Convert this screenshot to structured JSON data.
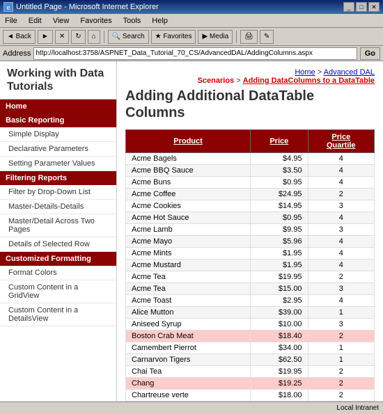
{
  "window": {
    "title": "Untitled Page - Microsoft Internet Explorer",
    "icon": "🌐"
  },
  "menu": {
    "items": [
      "File",
      "Edit",
      "View",
      "Favorites",
      "Tools",
      "Help"
    ]
  },
  "toolbar": {
    "back_label": "◄ Back",
    "search_label": "Search",
    "favorites_label": "★ Favorites",
    "media_label": "Media"
  },
  "address": {
    "label": "Address",
    "url": "http://localhost:3758/ASPNET_Data_Tutorial_70_CS/AdvancedDAL/AddingColumns.aspx",
    "go_label": "Go"
  },
  "page": {
    "title": "Working with Data Tutorials",
    "heading": "Adding Additional DataTable Columns"
  },
  "breadcrumb": {
    "home": "Home",
    "advanced_dal": "Advanced DAL",
    "scenarios": "Scenarios",
    "current": "Adding DataColumns to a DataTable"
  },
  "sidebar": {
    "home_label": "Home",
    "sections": [
      {
        "header": "Basic Reporting",
        "items": [
          "Simple Display",
          "Declarative Parameters",
          "Setting Parameter Values"
        ]
      },
      {
        "header": "Filtering Reports",
        "items": [
          "Filter by Drop-Down List",
          "Master-Details-Details",
          "Master/Detail Across Two Pages",
          "Details of Selected Row"
        ]
      },
      {
        "header": "Customized Formatting",
        "items": [
          "Format Colors",
          "Custom Content in a GridView",
          "Custom Content in a DetailsView"
        ]
      }
    ]
  },
  "table": {
    "headers": [
      "Product",
      "Price",
      "Price Quartile"
    ],
    "rows": [
      {
        "product": "Acme Bagels",
        "price": "$4.95",
        "quartile": "4"
      },
      {
        "product": "Acme BBQ Sauce",
        "price": "$3.50",
        "quartile": "4"
      },
      {
        "product": "Acme Buns",
        "price": "$0.95",
        "quartile": "4"
      },
      {
        "product": "Acme Coffee",
        "price": "$24.95",
        "quartile": "2"
      },
      {
        "product": "Acme Cookies",
        "price": "$14.95",
        "quartile": "3"
      },
      {
        "product": "Acme Hot Sauce",
        "price": "$0.95",
        "quartile": "4"
      },
      {
        "product": "Acme Lamb",
        "price": "$9.95",
        "quartile": "3"
      },
      {
        "product": "Acme Mayo",
        "price": "$5.96",
        "quartile": "4"
      },
      {
        "product": "Acme Mints",
        "price": "$1.95",
        "quartile": "4"
      },
      {
        "product": "Acme Mustard",
        "price": "$1.95",
        "quartile": "4"
      },
      {
        "product": "Acme Tea",
        "price": "$19.95",
        "quartile": "2"
      },
      {
        "product": "Acme Tea",
        "price": "$15.00",
        "quartile": "3"
      },
      {
        "product": "Acme Toast",
        "price": "$2.95",
        "quartile": "4"
      },
      {
        "product": "Alice Mutton",
        "price": "$39.00",
        "quartile": "1"
      },
      {
        "product": "Aniseed Syrup",
        "price": "$10.00",
        "quartile": "3"
      },
      {
        "product": "Boston Crab Meat",
        "price": "$18.40",
        "quartile": "2",
        "highlight": true
      },
      {
        "product": "Camembert Pierrot",
        "price": "$34.00",
        "quartile": "1"
      },
      {
        "product": "Carnarvon Tigers",
        "price": "$62.50",
        "quartile": "1"
      },
      {
        "product": "Chai Tea",
        "price": "$19.95",
        "quartile": "2"
      },
      {
        "product": "Chang",
        "price": "$19.25",
        "quartile": "2",
        "highlight": true
      },
      {
        "product": "Chartreuse verte",
        "price": "$18.00",
        "quartile": "2"
      }
    ]
  },
  "status": {
    "text": "",
    "zone": "Local Intranet"
  }
}
